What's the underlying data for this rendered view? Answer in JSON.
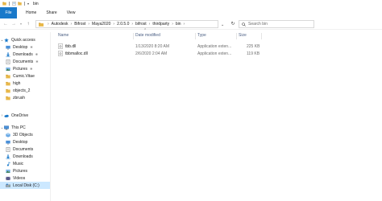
{
  "window": {
    "title": "bin"
  },
  "ribbon": {
    "file_tab": "File",
    "tabs": [
      "Home",
      "Share",
      "View"
    ]
  },
  "address": {
    "crumbs": [
      "Autodesk",
      "Bifrost",
      "Maya2020",
      "2.0.5.0",
      "bifrost",
      "thirdparty",
      "bin"
    ],
    "separator": "›"
  },
  "search": {
    "placeholder": "Search bin"
  },
  "sidebar": {
    "quick_access": "Quick access",
    "quick_items": [
      "Desktop",
      "Downloads",
      "Documents",
      "Pictures",
      "Cumic.Vitae",
      "high",
      "objects_2",
      "zbrush"
    ],
    "onedrive": "OneDrive",
    "this_pc": "This PC",
    "pc_items": [
      "3D Objects",
      "Desktop",
      "Documents",
      "Downloads",
      "Music",
      "Pictures",
      "Videos",
      "Local Disk (C:)"
    ]
  },
  "table": {
    "headers": {
      "name": "Name",
      "date": "Date modified",
      "type": "Type",
      "size": "Size"
    },
    "rows": [
      {
        "name": "tbb.dll",
        "date": "1/13/2020 8:20 AM",
        "type": "Application exten...",
        "size": "225 KB"
      },
      {
        "name": "tbbmalloc.dll",
        "date": "2/6/2020 2:04 AM",
        "type": "Application exten...",
        "size": "119 KB"
      }
    ]
  },
  "colors": {
    "accent": "#1979ca",
    "selection": "#cce8ff",
    "folder": "#e8b84a",
    "header_text": "#4d6185"
  }
}
